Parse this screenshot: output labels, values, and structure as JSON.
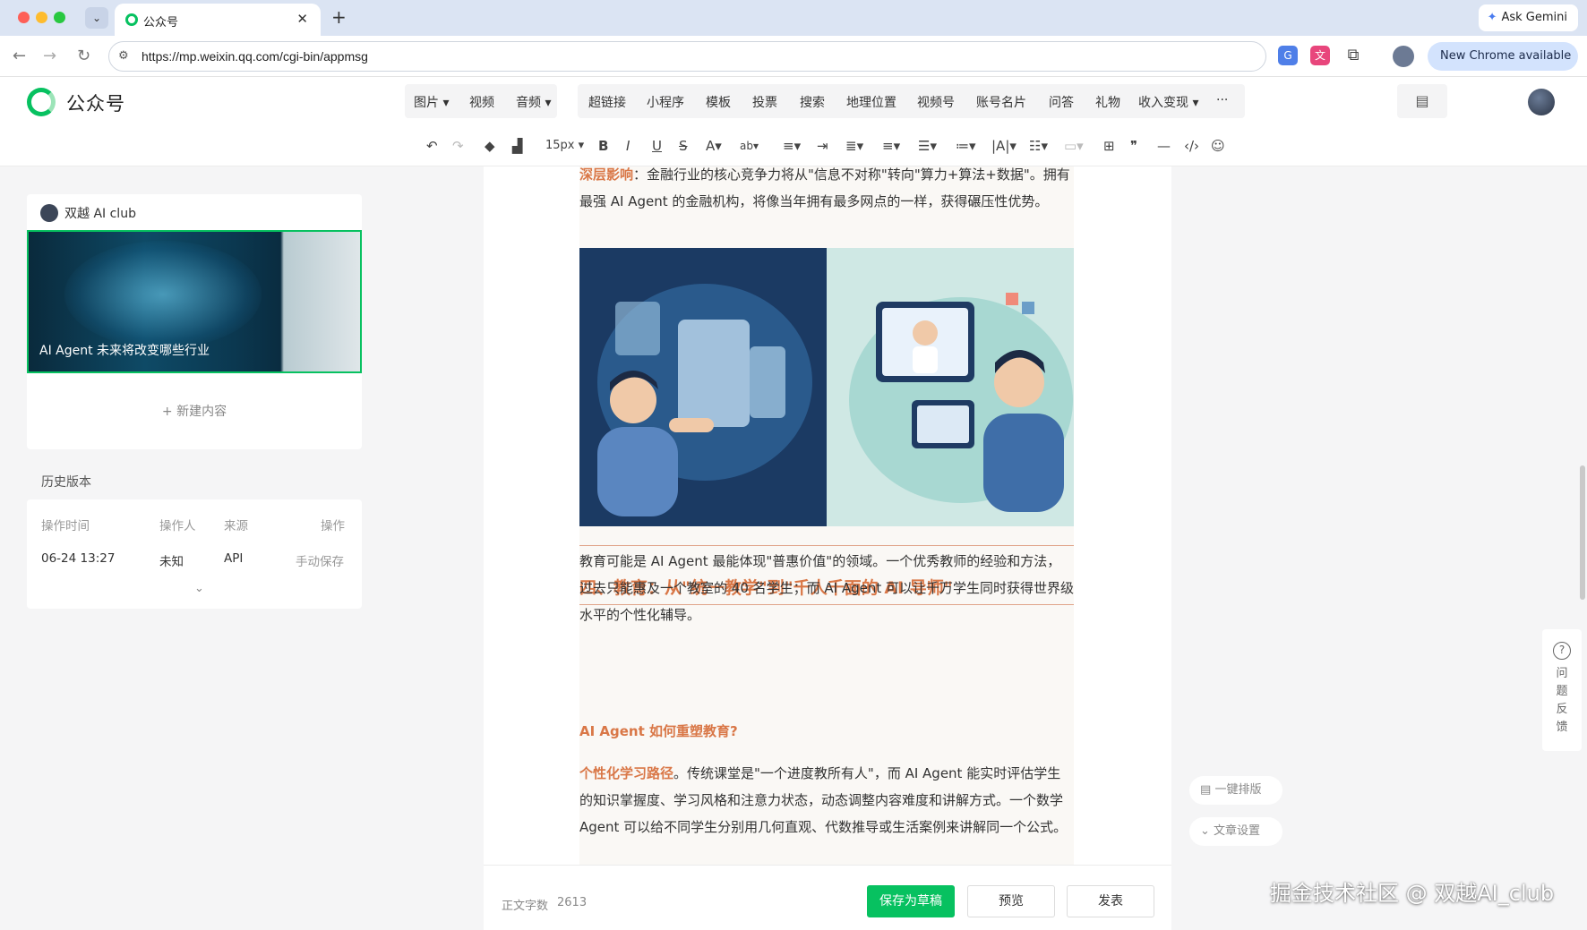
{
  "browser": {
    "tab_title": "公众号",
    "url": "https://mp.weixin.qq.com/cgi-bin/appmsg",
    "ask_gemini": "Ask Gemini",
    "new_chrome": "New Chrome available"
  },
  "header": {
    "brand": "公众号",
    "insert_group_1": [
      "图片",
      "视频",
      "音频"
    ],
    "insert_group_2": [
      "超链接",
      "小程序",
      "模板",
      "投票",
      "搜索",
      "地理位置",
      "视频号",
      "账号名片",
      "问答",
      "礼物",
      "收入变现"
    ],
    "more": "···"
  },
  "toolbar": {
    "font_size": "15px",
    "icons": [
      "undo-icon",
      "redo-icon",
      "format-painter-icon",
      "clear-format-icon",
      "bold-icon",
      "italic-icon",
      "underline-icon",
      "strikethrough-icon",
      "font-color-icon",
      "highlight-icon",
      "align-icon",
      "indent-icon",
      "line-spacing-icon",
      "paragraph-spacing-icon",
      "letter-spacing-icon",
      "list-icon",
      "table-icon",
      "quote-icon",
      "divider-icon",
      "code-icon",
      "emoji-icon"
    ]
  },
  "sidebar": {
    "account_name": "双越 AI club",
    "cover_title": "AI Agent 未来将改变哪些行业",
    "new_content": "新建内容",
    "history_title": "历史版本",
    "history_headers": [
      "操作时间",
      "操作人",
      "来源",
      "操作"
    ],
    "history_rows": [
      {
        "time": "06-24 13:27",
        "operator": "未知",
        "source": "API",
        "action": "手动保存"
      }
    ]
  },
  "article": {
    "p1_label": "深层影响",
    "p1_text": "：金融行业的核心竞争力将从\"信息不对称\"转向\"算力+算法+数据\"。拥有最强 AI Agent 的金融机构，将像当年拥有最多网点的一样，获得碾压性优势。",
    "heading": "四、教育：从\"统一教学\"到\"千人千面的 AI 导师\"",
    "p2_text": "教育可能是 AI Agent 最能体现\"普惠价值\"的领域。一个优秀教师的经验和方法，过去只能惠及一个教室的 40 名学生；而 AI Agent 可以让千万学生同时获得世界级水平的个性化辅导。",
    "subheading": "AI Agent 如何重塑教育?",
    "p3_label": "个性化学习路径",
    "p3_text": "。传统课堂是\"一个进度教所有人\"，而 AI Agent 能实时评估学生的知识掌握度、学习风格和注意力状态，动态调整内容难度和讲解方式。一个数学 Agent 可以给不同学生分别用几何直观、代数推导或生活案例来讲解同一个公式。"
  },
  "footer": {
    "word_count_label": "正文字数",
    "word_count": "2613",
    "save_draft": "保存为草稿",
    "preview": "预览",
    "publish": "发表"
  },
  "side_tools": {
    "auto_format": "一键排版",
    "article_settings": "文章设置",
    "feedback": "问题反馈"
  },
  "watermark": "掘金技术社区 @ 双越AI_club",
  "colors": {
    "accent": "#07c160",
    "emphasis": "#d97747"
  }
}
